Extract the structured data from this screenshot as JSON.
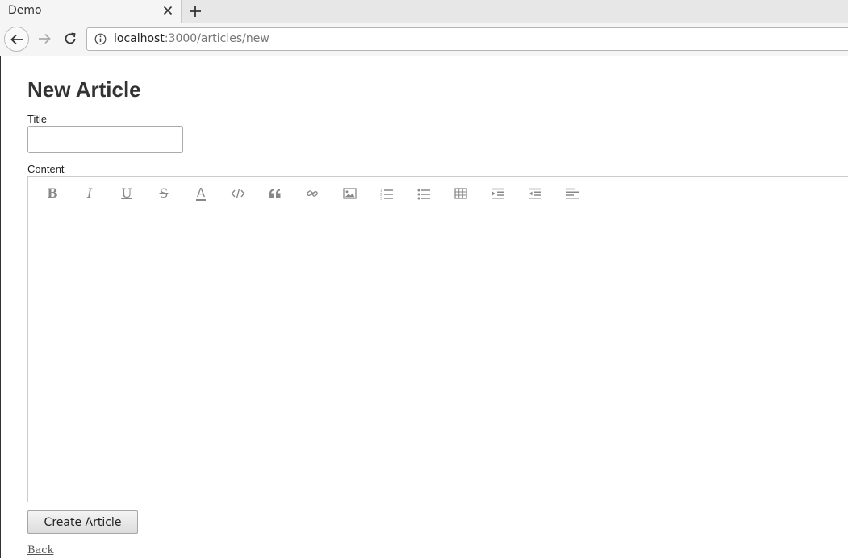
{
  "browser": {
    "tab_title": "Demo",
    "url_host": "localhost",
    "url_path": ":3000/articles/new"
  },
  "page": {
    "heading": "New Article",
    "title_label": "Title",
    "title_value": "",
    "content_label": "Content",
    "submit_label": "Create Article",
    "back_link": "Back"
  },
  "toolbar": {
    "tools": [
      {
        "name": "bold",
        "icon": "bold-icon",
        "glyph": "B"
      },
      {
        "name": "italic",
        "icon": "italic-icon",
        "glyph": "I"
      },
      {
        "name": "underline",
        "icon": "underline-icon",
        "glyph": "U"
      },
      {
        "name": "strikethrough",
        "icon": "strikethrough-icon",
        "glyph": "S"
      },
      {
        "name": "font-color",
        "icon": "font-color-icon",
        "glyph": "A"
      },
      {
        "name": "code",
        "icon": "code-icon"
      },
      {
        "name": "blockquote",
        "icon": "quote-icon"
      },
      {
        "name": "link",
        "icon": "link-icon"
      },
      {
        "name": "image",
        "icon": "image-icon"
      },
      {
        "name": "ordered-list",
        "icon": "ordered-list-icon"
      },
      {
        "name": "unordered-list",
        "icon": "unordered-list-icon"
      },
      {
        "name": "table",
        "icon": "table-icon"
      },
      {
        "name": "indent",
        "icon": "indent-icon"
      },
      {
        "name": "outdent",
        "icon": "outdent-icon"
      },
      {
        "name": "alignment",
        "icon": "align-left-icon"
      }
    ]
  }
}
